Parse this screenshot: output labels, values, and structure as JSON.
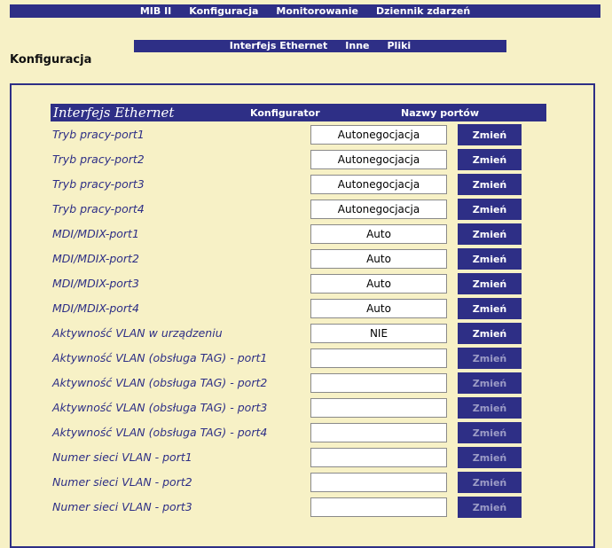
{
  "top_nav": [
    "MIB II",
    "Konfiguracja",
    "Monitorowanie",
    "Dziennik zdarzeń"
  ],
  "sub_nav": [
    "Interfejs Ethernet",
    "Inne",
    "Pliki"
  ],
  "page_title": "Konfiguracja",
  "table_header": {
    "title": "Interfejs Ethernet",
    "configurator": "Konfigurator",
    "port_names": "Nazwy portów"
  },
  "rows": [
    {
      "label": "Tryb pracy-port1",
      "value": "Autonegocjacja",
      "button": "Zmień"
    },
    {
      "label": "Tryb pracy-port2",
      "value": "Autonegocjacja",
      "button": "Zmień"
    },
    {
      "label": "Tryb pracy-port3",
      "value": "Autonegocjacja",
      "button": "Zmień"
    },
    {
      "label": "Tryb pracy-port4",
      "value": "Autonegocjacja",
      "button": "Zmień"
    },
    {
      "label": "MDI/MDIX-port1",
      "value": "Auto",
      "button": "Zmień"
    },
    {
      "label": "MDI/MDIX-port2",
      "value": "Auto",
      "button": "Zmień"
    },
    {
      "label": "MDI/MDIX-port3",
      "value": "Auto",
      "button": "Zmień"
    },
    {
      "label": "MDI/MDIX-port4",
      "value": "Auto",
      "button": "Zmień"
    },
    {
      "label": "Aktywność VLAN w urządzeniu",
      "value": "NIE",
      "button": "Zmień"
    },
    {
      "label": "Aktywność VLAN (obsługa TAG) - port1",
      "value": "",
      "button": "Zmień"
    },
    {
      "label": "Aktywność VLAN (obsługa TAG) - port2",
      "value": "",
      "button": "Zmień"
    },
    {
      "label": "Aktywność VLAN (obsługa TAG) - port3",
      "value": "",
      "button": "Zmień"
    },
    {
      "label": "Aktywność VLAN (obsługa TAG) - port4",
      "value": "",
      "button": "Zmień"
    },
    {
      "label": "Numer sieci VLAN - port1",
      "value": "",
      "button": "Zmień"
    },
    {
      "label": "Numer sieci VLAN - port2",
      "value": "",
      "button": "Zmień"
    },
    {
      "label": "Numer sieci VLAN - port3",
      "value": "",
      "button": "Zmień"
    }
  ],
  "colors": {
    "background": "#f7f1c6",
    "navy": "#2e2f86",
    "disabled_button_text": "#9c9cc6"
  }
}
